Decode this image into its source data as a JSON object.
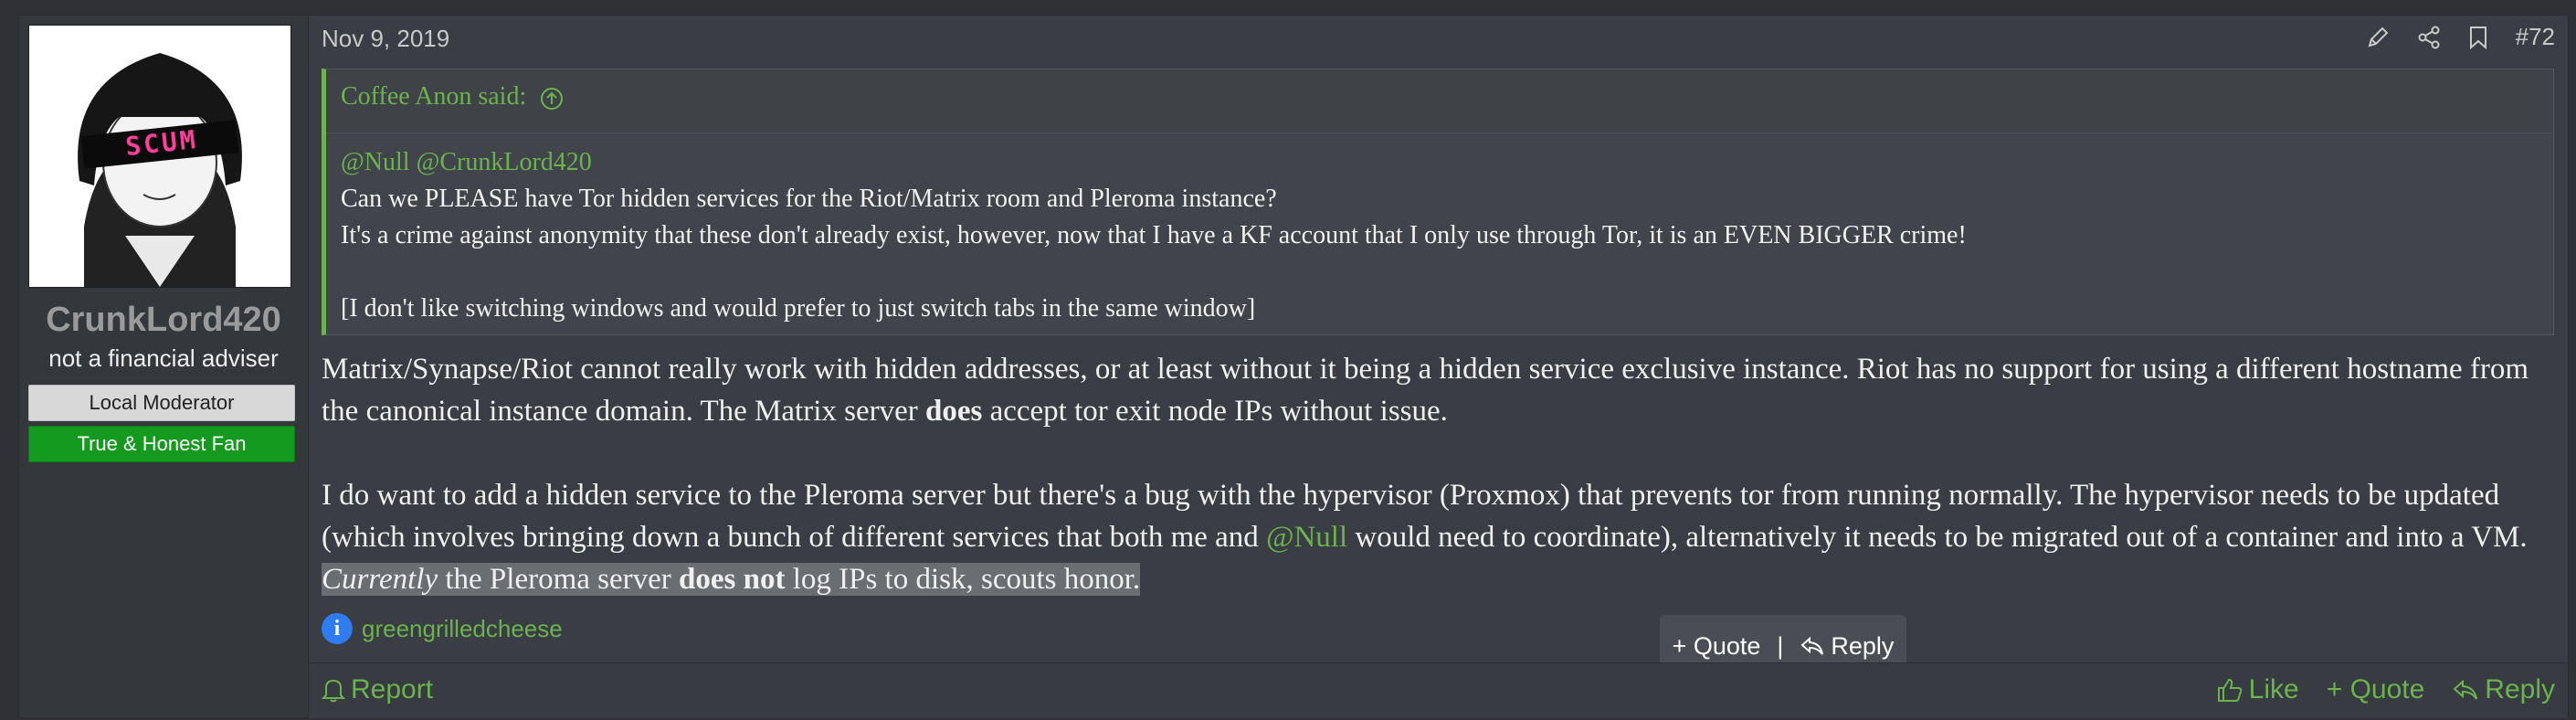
{
  "post": {
    "date": "Nov 9, 2019",
    "number": "#72",
    "author": {
      "username": "CrunkLord420",
      "title": "not a financial adviser",
      "banners": [
        "Local Moderator",
        "True & Honest Fan"
      ],
      "avatar_text": "SCUM"
    },
    "quote": {
      "header": "Coffee Anon said:",
      "mentions": "@Null @CrunkLord420",
      "lines": [
        "Can we PLEASE have Tor hidden services for the Riot/Matrix room and Pleroma instance?",
        "It's a crime against anonymity that these don't already exist, however, now that I have a KF account that I only use through Tor, it is an EVEN BIGGER crime!",
        "[I don't like switching windows and would prefer to just switch tabs in the same window]"
      ]
    },
    "body": {
      "p1_a": "Matrix/Synapse/Riot cannot really work with hidden addresses, or at least without it being a hidden service exclusive instance. Riot has no support for using a different hostname from the canonical instance domain. The Matrix server ",
      "p1_bold": "does",
      "p1_b": " accept tor exit node IPs without issue.",
      "p2_a": "I do want to add a hidden service to the Pleroma server but there's a bug with the hypervisor (Proxmox) that prevents tor from running normally. The hypervisor needs to be updated (which involves bringing down a bunch of different services that both me and ",
      "p2_mention": "@Null",
      "p2_b": " would need to coordinate), alternatively it needs to be migrated out of a container and into a VM. ",
      "p2_italic": "Currently",
      "p2_c": " the Pleroma server ",
      "p2_bold": "does not",
      "p2_d": " log IPs to disk, scouts honor."
    },
    "reactions": {
      "user": "greengrilledcheese"
    },
    "popup": {
      "quote": "+ Quote",
      "sep": "|",
      "reply": "Reply"
    },
    "footer": {
      "report": "Report",
      "like": "Like",
      "quote": "+ Quote",
      "reply": "Reply"
    }
  },
  "colors": {
    "accent": "#6bb34e",
    "fan_banner": "#139a1f",
    "background": "#3a3d43"
  }
}
